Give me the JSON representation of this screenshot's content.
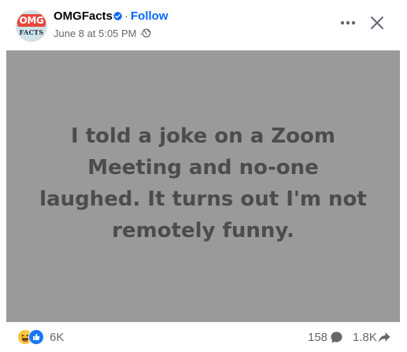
{
  "post": {
    "page_name": "OMGFacts",
    "separator": "·",
    "follow_label": "Follow",
    "timestamp": "June 8 at 5:05 PM ·",
    "avatar": {
      "top_text": "OMG",
      "bottom_text": "FACTS"
    },
    "image_text": "I told a joke on a Zoom Meeting and no-one laughed. It turns out I'm not remotely funny.",
    "icons": {
      "verified": "verified-badge-icon",
      "audience": "globe-icon",
      "more": "more-horizontal-icon",
      "close": "close-icon",
      "haha": "haha-reaction-icon",
      "like": "like-reaction-icon",
      "comment": "comment-icon",
      "share": "share-icon"
    }
  },
  "footer": {
    "reaction_count": "6K",
    "comment_count": "158",
    "share_count": "1.8K"
  },
  "colors": {
    "link": "#0866ff",
    "verified": "#0866ff",
    "image_bg": "#9a9a9a",
    "image_text": "#4c4c4c",
    "secondary_text": "#65676b"
  }
}
